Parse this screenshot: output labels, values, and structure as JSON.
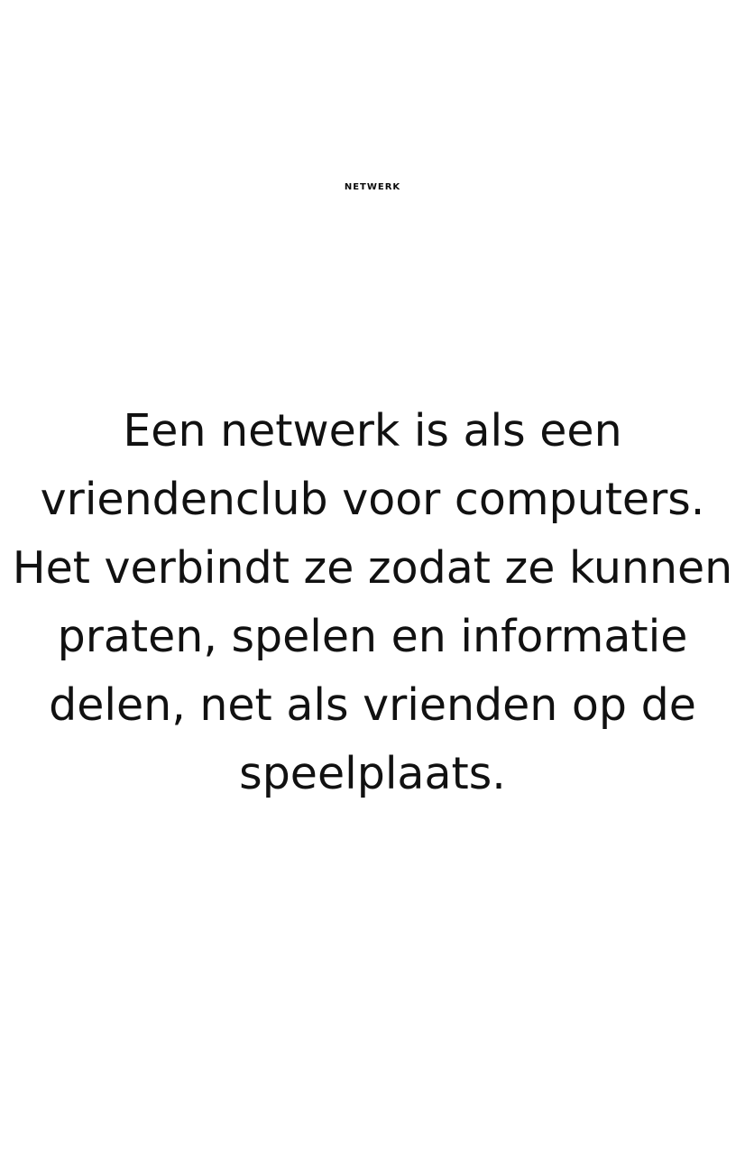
{
  "title": "NETWERK",
  "body": {
    "lines": [
      "Een netwerk is als een",
      "vriendenclub voor computers.",
      "Het verbindt ze zodat ze kunnen",
      "praten, spelen en informatie",
      "delen, net als vrienden op de",
      "speelplaats."
    ]
  },
  "colors": {
    "background": "#ffffff",
    "text": "#111111"
  }
}
